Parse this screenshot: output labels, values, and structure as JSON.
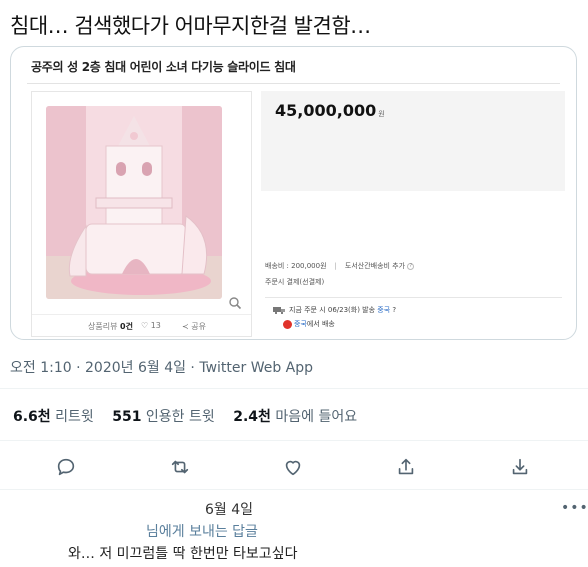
{
  "tweet": {
    "text": "침대… 검색했다가 어마무지한걸 발견함…"
  },
  "product_card": {
    "title": "공주의 성 2층 침대 어린이 소녀 다기능 슬라이드 침대",
    "price": "45,000,000",
    "price_unit": "원",
    "review_label": "상품리뷰",
    "review_count": "0건",
    "like_count": "13",
    "share_label": "공유",
    "shipping_fee": "배송비 : 200,000원",
    "remote_shipping": "도서산간배송비 추가",
    "payment": "주문시 결제(선결제)",
    "delivery_estimate": "지금 주문 시 06/23(화) 발송",
    "delivery_origin_tag": "중국",
    "origin_country": "중국",
    "origin_suffix": "에서 배송"
  },
  "meta": {
    "timestamp": "오전 1:10 · 2020년 6월 4일 · Twitter Web App"
  },
  "counts": {
    "retweets_value": "6.6천",
    "retweets_label": "리트윗",
    "quotes_value": "551",
    "quotes_label": "인용한 트윗",
    "likes_value": "2.4천",
    "likes_label": "마음에 들어요"
  },
  "actions": [
    "reply-icon",
    "retweet-icon",
    "like-icon",
    "share-icon",
    "download-icon"
  ],
  "reply": {
    "date": "6월 4일",
    "replying_to": "님에게 보내는 답글",
    "text": "와… 저 미끄럼틀 딱 한번만 타보고싶다"
  },
  "colors": {
    "text": "#0f1419",
    "muted": "#536471",
    "border": "#cfd9de",
    "link": "#5a7f9c"
  }
}
